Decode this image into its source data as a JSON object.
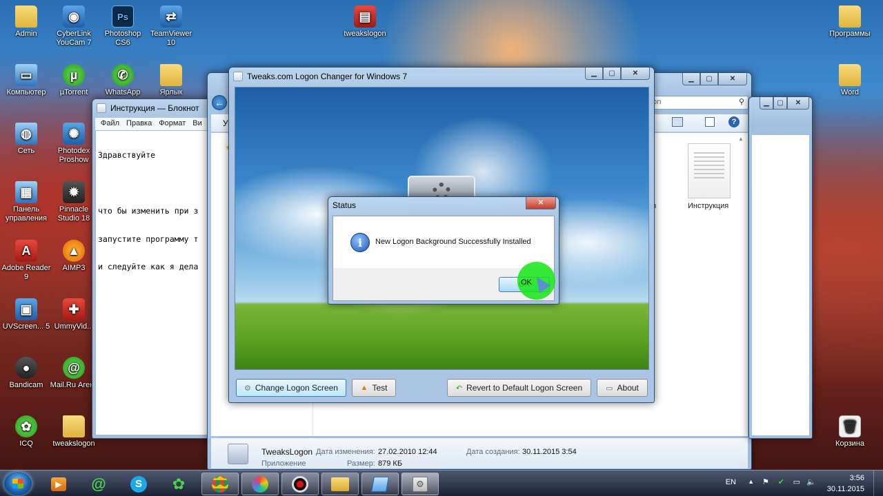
{
  "desktop": {
    "icons": [
      {
        "label": "Admin",
        "icon": "folder-icon"
      },
      {
        "label": "CyberLink YouCam 7",
        "icon": "youcam-icon"
      },
      {
        "label": "Photoshop CS6",
        "icon": "photoshop-icon"
      },
      {
        "label": "TeamViewer 10",
        "icon": "teamviewer-icon"
      },
      {
        "label": "tweakslogon",
        "icon": "winrar-archive-icon"
      },
      {
        "label": "Программы",
        "icon": "folder-icon"
      },
      {
        "label": "Компьютер",
        "icon": "computer-icon"
      },
      {
        "label": "µTorrent",
        "icon": "utorrent-icon"
      },
      {
        "label": "WhatsApp",
        "icon": "whatsapp-icon"
      },
      {
        "label": "Ярлык",
        "icon": "folder-icon"
      },
      {
        "label": "Word",
        "icon": "folder-icon"
      },
      {
        "label": "Сеть",
        "icon": "network-icon"
      },
      {
        "label": "Photodex Proshow",
        "icon": "proshow-icon"
      },
      {
        "label": "Панель управления",
        "icon": "control-panel-icon"
      },
      {
        "label": "Pinnacle Studio 18",
        "icon": "pinnacle-icon"
      },
      {
        "label": "Adobe Reader 9",
        "icon": "adobe-reader-icon"
      },
      {
        "label": "AIMP3",
        "icon": "aimp-icon"
      },
      {
        "label": "UVScreen... 5",
        "icon": "uvscreen-icon"
      },
      {
        "label": "UmmyVid...",
        "icon": "ummyvideo-icon"
      },
      {
        "label": "Bandicam",
        "icon": "bandicam-icon"
      },
      {
        "label": "Mail.Ru Агент",
        "icon": "mailru-agent-icon"
      },
      {
        "label": "ICQ",
        "icon": "icq-icon"
      },
      {
        "label": "tweakslogon",
        "icon": "folder-icon"
      },
      {
        "label": "Корзина",
        "icon": "recycle-bin-icon"
      }
    ]
  },
  "notepad": {
    "title": "Инструкция — Блокнот",
    "menu": [
      "Файл",
      "Правка",
      "Формат",
      "Ви"
    ],
    "lines": [
      "Здравствуйте",
      "",
      "что бы изменить при з",
      "запустите программу т",
      "и следуйте как я дела"
    ]
  },
  "explorer": {
    "search_text": "gon",
    "toolbar_fragment": "Уг",
    "file_name": "Инструкция",
    "partial_file": "on",
    "details": {
      "name": "TweaksLogon",
      "type": "Приложение",
      "modified_label": "Дата изменения:",
      "modified_value": "27.02.2010 12:44",
      "size_label": "Размер:",
      "size_value": "879 КБ",
      "created_label": "Дата создания:",
      "created_value": "30.11.2015 3:54"
    }
  },
  "tweaks": {
    "title": "Tweaks.com Logon Changer for Windows 7",
    "buttons": {
      "change": "Change Logon Screen",
      "test": "Test",
      "revert": "Revert to Default Logon Screen",
      "about": "About"
    }
  },
  "dialog": {
    "title": "Status",
    "message": "New Logon Background Successfully Installed",
    "ok": "OK"
  },
  "taskbar": {
    "lang": "EN",
    "time": "3:56",
    "date": "30.11.2015"
  }
}
